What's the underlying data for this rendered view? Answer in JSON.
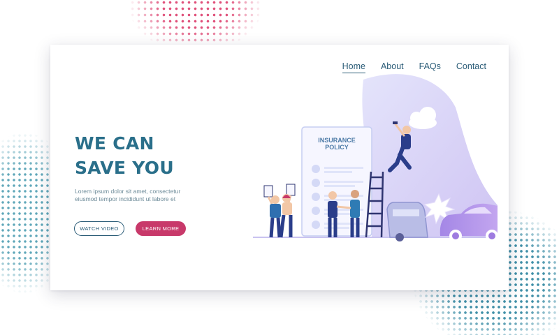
{
  "nav": {
    "items": [
      {
        "label": "Home",
        "active": true
      },
      {
        "label": "About",
        "active": false
      },
      {
        "label": "FAQs",
        "active": false
      },
      {
        "label": "Contact",
        "active": false
      }
    ]
  },
  "hero": {
    "headline_line1": "WE CAN",
    "headline_line2": "SAVE YOU",
    "body_line1": "Lorem ipsum dolor sit amet, consectetur",
    "body_line2": "eiusmod tempor incididunt ut labore et",
    "watch_video_label": "WATCH VIDEO",
    "learn_more_label": "LEARN MORE"
  },
  "illustration": {
    "policy_line1": "INSURANCE",
    "policy_line2": "POLICY"
  },
  "colors": {
    "primary": "#2a6f8a",
    "accent": "#c8396a",
    "illustration_purple": "#9e7be0",
    "card_background": "#ffffff"
  }
}
